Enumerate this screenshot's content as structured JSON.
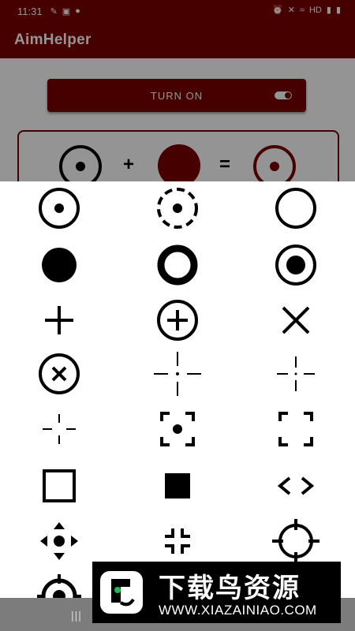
{
  "status_bar": {
    "time": "11:31",
    "hd": "HD"
  },
  "app": {
    "title": "AimHelper",
    "turn_on_label": "TURN ON",
    "plus": "+",
    "equals": "="
  },
  "crosshairs": [
    "dot-circle-icon",
    "dashed-dot-circle-icon",
    "ring-icon",
    "solid-dot-icon",
    "thick-ring-icon",
    "ring-dot-icon",
    "plus-icon",
    "circle-plus-icon",
    "x-icon",
    "circle-x-icon",
    "dashed-cross-dot-icon",
    "gap-cross-dot-icon",
    "small-gap-cross-icon",
    "bracket-dot-icon",
    "bracket-corners-icon",
    "square-outline-icon",
    "filled-square-icon",
    "chevrons-icon",
    "dpad-arrows-icon",
    "inward-corners-icon",
    "scope-ring-icon",
    "scope-dot-icon"
  ],
  "watermark": {
    "cn": "下载鸟资源",
    "url": "WWW.XIAZAINIAO.COM"
  },
  "nav": {
    "recents": "|||"
  },
  "colors": {
    "primary": "#7a0000",
    "scrim": "rgba(0,0,0,0.42)"
  }
}
